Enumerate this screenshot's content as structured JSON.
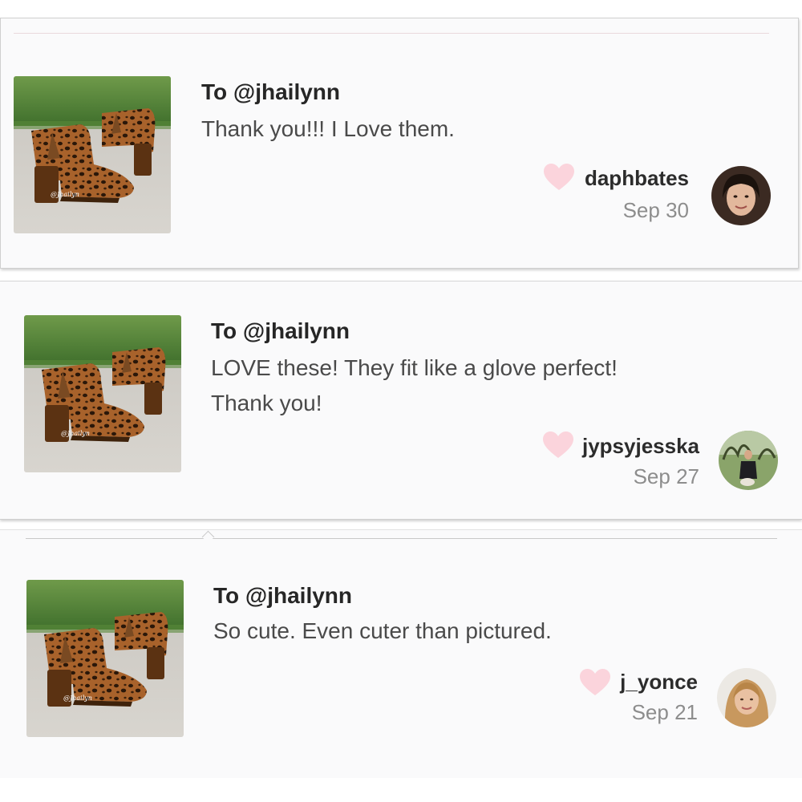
{
  "reviews": [
    {
      "to": "To @jhailynn",
      "message_lines": [
        "Thank you!!! I Love them."
      ],
      "username": "daphbates",
      "date": "Sep 30",
      "photo_watermark": "@Jhailyn"
    },
    {
      "to": "To @jhailynn",
      "message_lines": [
        "LOVE these! They fit like a glove perfect!",
        "Thank you!"
      ],
      "username": "jypsyjesska",
      "date": "Sep 27",
      "photo_watermark": "@Jhailyn"
    },
    {
      "to": "To @jhailynn",
      "message_lines": [
        "So cute. Even cuter than pictured."
      ],
      "username": "j_yonce",
      "date": "Sep 21",
      "photo_watermark": "@Jhailyn"
    }
  ],
  "colors": {
    "heart": "#fbd4dc",
    "card_bg": "#fafafb",
    "username": "#2c2c2c",
    "date": "#8d8d8d"
  },
  "icons": [
    "heart-icon",
    "avatar",
    "product-photo"
  ]
}
